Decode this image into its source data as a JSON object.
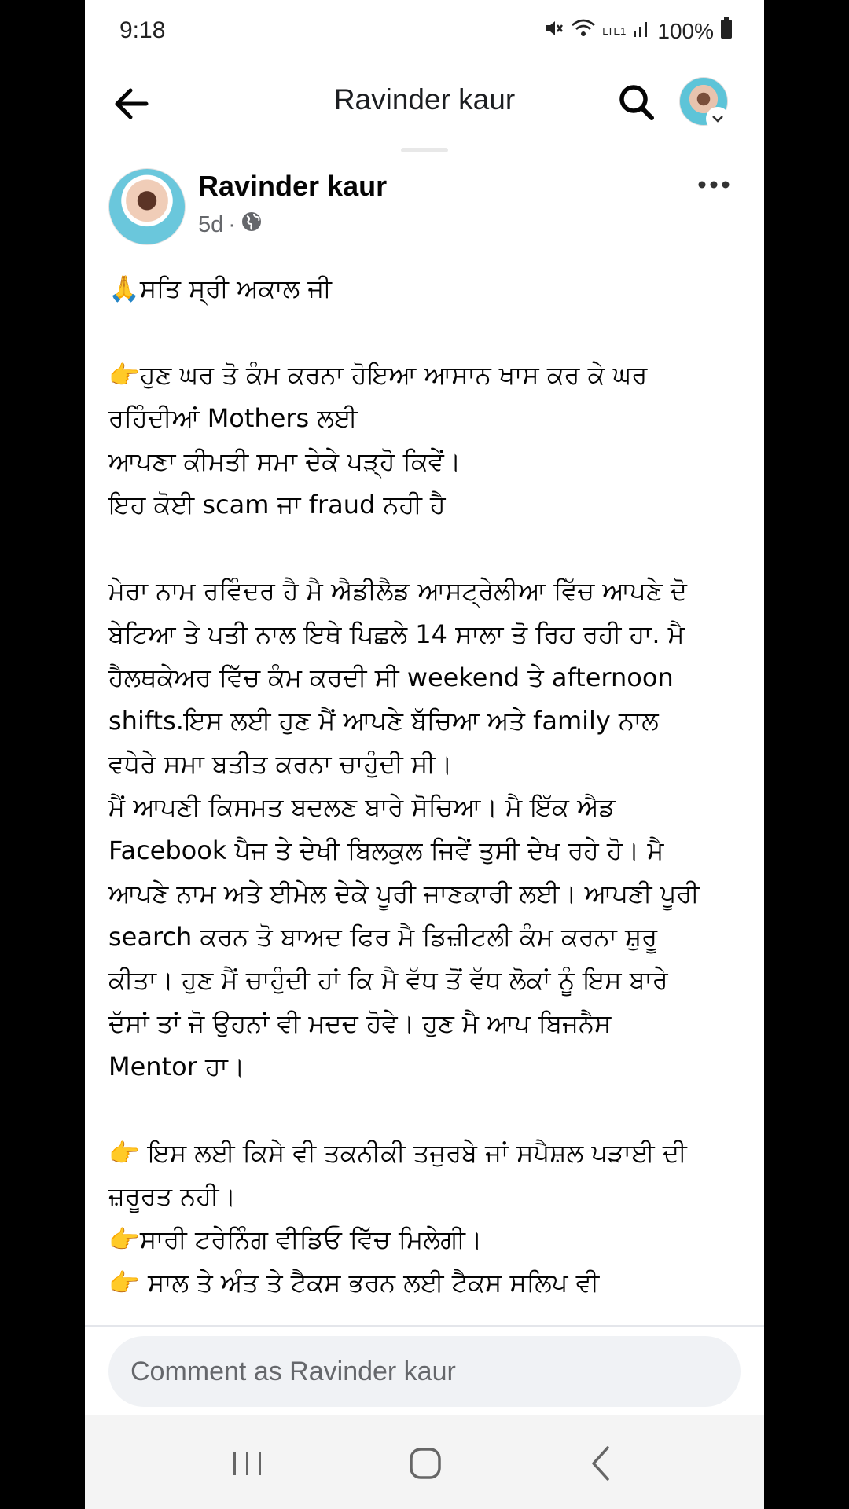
{
  "status_bar": {
    "time": "9:18",
    "battery": "100%",
    "net_label": "LTE1"
  },
  "header": {
    "title": "Ravinder kaur"
  },
  "post": {
    "author": "Ravinder kaur",
    "time": "5d",
    "separator": "·",
    "lines": [
      "🙏ਸਤਿ ਸ੍ਰੀ ਅਕਾਲ ਜੀ",
      "",
      "👉ਹੁਣ ਘਰ ਤੋ ਕੰਮ ਕਰਨਾ ਹੋਇਆ ਆਸਾਨ ਖਾਸ ਕਰ ਕੇ ਘਰ",
      "ਰਹਿੰਦੀਆਂ Mothers ਲਈ",
      "ਆਪਣਾ ਕੀਮਤੀ ਸਮਾ ਦੇਕੇ ਪੜ੍ਹੋ ਕਿਵੇਂ।",
      "ਇਹ ਕੋਈ scam ਜਾ fraud ਨਹੀ ਹੈ",
      "",
      "ਮੇਰਾ ਨਾਮ ਰਵਿੰਦਰ ਹੈ ਮੈ ਐਡੀਲੈਡ ਆਸਟ੍ਰੇਲੀਆ ਵਿੱਚ ਆਪਣੇ ਦੋ",
      "ਬੇਟਿਆ ਤੇ ਪਤੀ ਨਾਲ ਇਥੇ ਪਿਛਲੇ 14 ਸਾਲਾ ਤੋ ਰਿਹ ਰਹੀ ਹਾ. ਮੈ",
      "ਹੈਲਥਕੇਅਰ ਵਿੱਚ  ਕੰਮ ਕਰਦੀ ਸੀ  weekend  ਤੇ afternoon",
      "shifts.ਇਸ ਲਈ ਹੁਣ ਮੈਂ ਆਪਣੇ ਬੱਚਿਆ ਅਤੇ family ਨਾਲ",
      "ਵਧੇਰੇ ਸਮਾ ਬਤੀਤ ਕਰਨਾ ਚਾਹੁੰਦੀ ਸੀ।",
      "ਮੈਂ ਆਪਣੀ ਕਿਸਮਤ ਬਦਲਣ ਬਾਰੇ ਸੋਚਿਆ। ਮੈ ਇੱਕ ਐਡ",
      "Facebook ਪੈਜ ਤੇ ਦੇਖੀ ਬਿਲਕੁਲ ਜਿਵੇਂ ਤੁਸੀ ਦੇਖ ਰਹੇ ਹੋ। ਮੈ",
      "ਆਪਣੇ ਨਾਮ ਅਤੇ ਈਮੇਲ ਦੇਕੇ ਪੂਰੀ ਜਾਣਕਾਰੀ ਲਈ। ਆਪਣੀ ਪੂਰੀ",
      "search ਕਰਨ ਤੋ ਬਾਅਦ ਫਿਰ ਮੈ ਡਿਜ਼ੀਟਲੀ ਕੰਮ ਕਰਨਾ ਸ਼ੁਰੂ",
      "ਕੀਤਾ। ਹੁਣ ਮੈਂ ਚਾਹੁੰਦੀ ਹਾਂ ਕਿ ਮੈ ਵੱਧ ਤੋਂ ਵੱਧ ਲੋਕਾਂ ਨੂੰ ਇਸ ਬਾਰੇ",
      "ਦੱਸਾਂ ਤਾਂ ਜੋ ਉਹਨਾਂ ਵੀ ਮਦਦ ਹੋਵੇ। ਹੁਣ ਮੈ ਆਪ ਬਿਜਨੈਸ",
      "Mentor ਹਾ।",
      "",
      "👉 ਇਸ ਲਈ ਕਿਸੇ ਵੀ ਤਕਨੀਕੀ ਤਜੁਰਬੇ ਜਾਂ ਸਪੈਸ਼ਲ ਪੜਾਈ ਦੀ",
      "ਜ਼ਰੂਰਤ ਨਹੀ।",
      "👉ਸਾਰੀ ਟਰੇਨਿੰਗ ਵੀਡਿਓ ਵਿੱਚ ਮਿਲੇਗੀ।",
      "👉 ਸਾਲ ਤੇ ਅੰਤ ਤੇ ਟੈਕਸ ਭਰਨ ਲਈ ਟੈਕਸ ਸਲਿਪ ਵੀ"
    ]
  },
  "comment_bar": {
    "placeholder": "Comment as Ravinder kaur"
  }
}
